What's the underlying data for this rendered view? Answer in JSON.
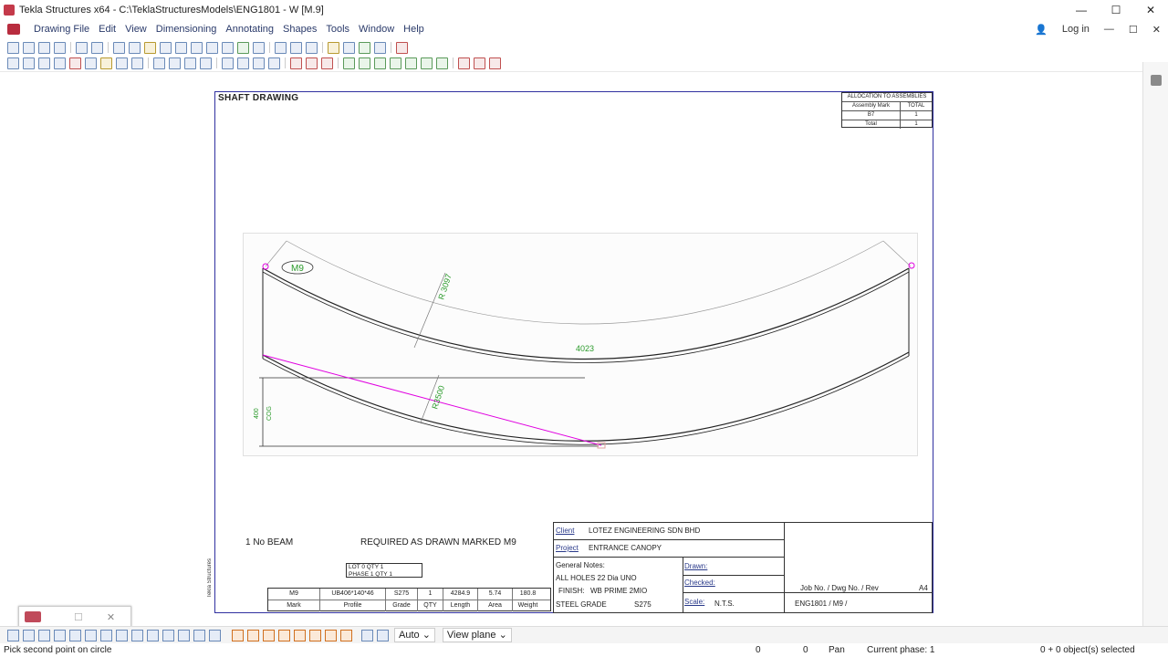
{
  "window": {
    "title": "Tekla Structures x64 - C:\\TeklaStructuresModels\\ENG1801 - W   [M.9]",
    "minimize": "—",
    "maximize": "☐",
    "close": "✕"
  },
  "menu": {
    "items": [
      "Drawing File",
      "Edit",
      "View",
      "Dimensioning",
      "Annotating",
      "Shapes",
      "Tools",
      "Window",
      "Help"
    ],
    "login": "Log in"
  },
  "drawing": {
    "title": "SHAFT DRAWING",
    "allocation": {
      "title": "ALLOCATION TO ASSEMBLIES",
      "col1": "Assembly Mark",
      "col2": "TOTAL",
      "rows": [
        [
          "B7",
          "1"
        ],
        [
          "Total",
          "1"
        ]
      ]
    },
    "part_mark": "M9",
    "dims": {
      "radius_top": "R 3097",
      "radius_bottom": "R3500",
      "length": "4023",
      "height": "400",
      "cog": "COG"
    },
    "note_qty": "1  No  BEAM",
    "note_required": "REQUIRED AS DRAWN MARKED   M9",
    "lot": {
      "line1": "LOT     0    QTY   1",
      "line2": "PHASE   1    QTY   1"
    },
    "part_table": {
      "values": [
        "M9",
        "UB406*140*46",
        "S275",
        "1",
        "4284.9",
        "5.74",
        "180.8"
      ],
      "headers": [
        "Mark",
        "Profile",
        "Grade",
        "QTY",
        "Length",
        "Area",
        "Weight"
      ]
    },
    "titleblock": {
      "client_label": "Client",
      "client": "LOTEZ ENGINEERING SDN BHD",
      "project_label": "Project",
      "project": "ENTRANCE CANOPY",
      "general_notes": "General Notes:",
      "holes": "ALL HOLES  22   Dia UNO",
      "finish_label": "FINISH:",
      "finish": "WB PRIME 2MIO",
      "steel_label": "STEEL GRADE",
      "steel": "S275",
      "drawn": "Drawn:",
      "checked": "Checked:",
      "scale_label": "Scale:",
      "scale": "N.T.S.",
      "job_header": "Job No.     /  Dwg No.  /  Rev",
      "job_values": "ENG1801    /       M9       /",
      "size": "A4"
    },
    "side_label": "Tekla Structures"
  },
  "bottom": {
    "snap_mode": "Auto",
    "view_mode": "View plane"
  },
  "status": {
    "prompt": "Pick second point on circle",
    "coord_x": "0",
    "coord_y": "0",
    "mode": "Pan",
    "phase": "Current phase: 1",
    "selection": "0 + 0 object(s) selected"
  },
  "colors": {
    "magenta": "#e000e0",
    "dim_green": "#2a9a2a",
    "sheet_border": "#3030a0"
  }
}
